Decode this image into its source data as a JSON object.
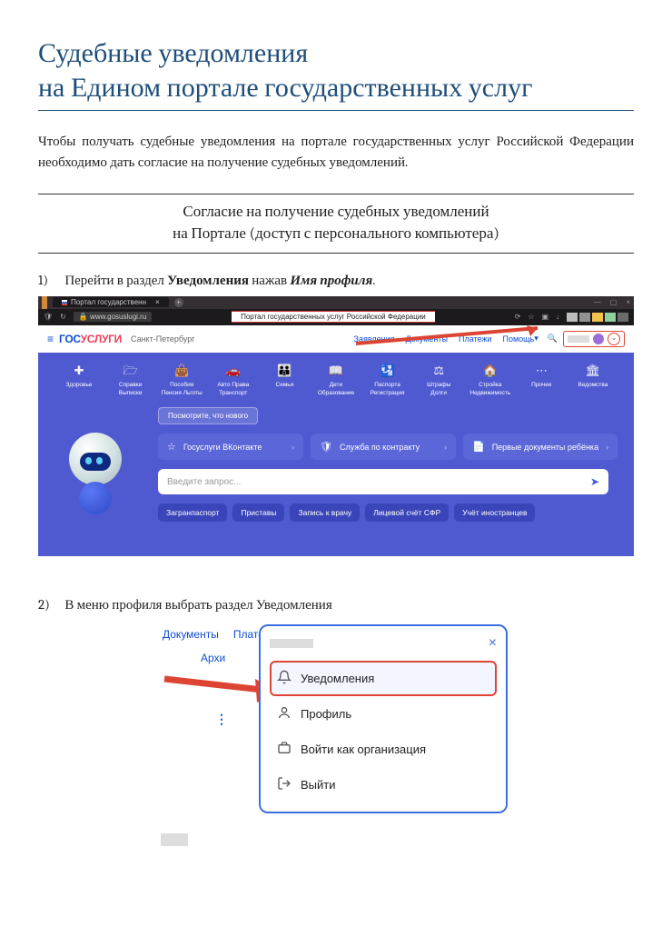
{
  "title_line1": "Судебные уведомления",
  "title_line2": "на Едином портале государственных услуг",
  "intro": "Чтобы получать судебные уведомления на портале государственных услуг Российской Федерации необходимо дать согласие на получение судебных уведомлений.",
  "section_line1": "Согласие на получение судебных уведомлений",
  "section_line2": "на Портале (доступ с персонального компьютера)",
  "step1_num": "1)",
  "step1_a": "Перейти в раздел ",
  "step1_b": "Уведомления",
  "step1_c": " нажав ",
  "step1_d": "Имя профиля",
  "step1_e": ".",
  "step2_num": "2)",
  "step2_txt": "В меню профиля выбрать раздел Уведомления",
  "shot1": {
    "tab": "Портал государственн",
    "url": "www.gosuslugi.ru",
    "urlmid": "Портал государственных услуг Российской Федерации",
    "logo_a": "ГОС",
    "logo_b": "УСЛУГИ",
    "city": "Санкт-Петербург",
    "nav": [
      "Заявления",
      "Документы",
      "Платежи",
      "Помощь"
    ],
    "cats": [
      {
        "icon": "✚",
        "l1": "Здоровье",
        "l2": ""
      },
      {
        "icon": "🗁",
        "l1": "Справки",
        "l2": "Выписки"
      },
      {
        "icon": "👜",
        "l1": "Пособия",
        "l2": "Пенсия Льготы"
      },
      {
        "icon": "🚗",
        "l1": "Авто Права",
        "l2": "Транспорт"
      },
      {
        "icon": "👪",
        "l1": "Семья",
        "l2": ""
      },
      {
        "icon": "📖",
        "l1": "Дети",
        "l2": "Образование"
      },
      {
        "icon": "🛂",
        "l1": "Паспорта",
        "l2": "Регистрация"
      },
      {
        "icon": "⚖",
        "l1": "Штрафы",
        "l2": "Долги"
      },
      {
        "icon": "🏠",
        "l1": "Стройка",
        "l2": "Недвижимость"
      },
      {
        "icon": "⋯",
        "l1": "Прочее",
        "l2": ""
      },
      {
        "icon": "🏛",
        "l1": "Ведомства",
        "l2": ""
      }
    ],
    "whatsnew": "Посмотрите, что нового",
    "cards": [
      {
        "icon": "☆",
        "txt": "Госуслуги ВКонтакте"
      },
      {
        "icon": "🛡",
        "txt": "Служба по контракту"
      },
      {
        "icon": "📄",
        "txt": "Первые документы ребёнка"
      }
    ],
    "placeholder": "Введите запрос...",
    "chips": [
      "Загранпаспорт",
      "Приставы",
      "Запись к врачу",
      "Лицевой счёт СФР",
      "Учёт иностранцев"
    ]
  },
  "shot2": {
    "top": [
      "Документы",
      "Плате"
    ],
    "archive": "Архи",
    "menu": [
      {
        "icon": "bell",
        "txt": "Уведомления",
        "sel": true
      },
      {
        "icon": "person",
        "txt": "Профиль",
        "sel": false
      },
      {
        "icon": "briefcase",
        "txt": "Войти как организация",
        "sel": false
      },
      {
        "icon": "exit",
        "txt": "Выйти",
        "sel": false
      }
    ]
  }
}
